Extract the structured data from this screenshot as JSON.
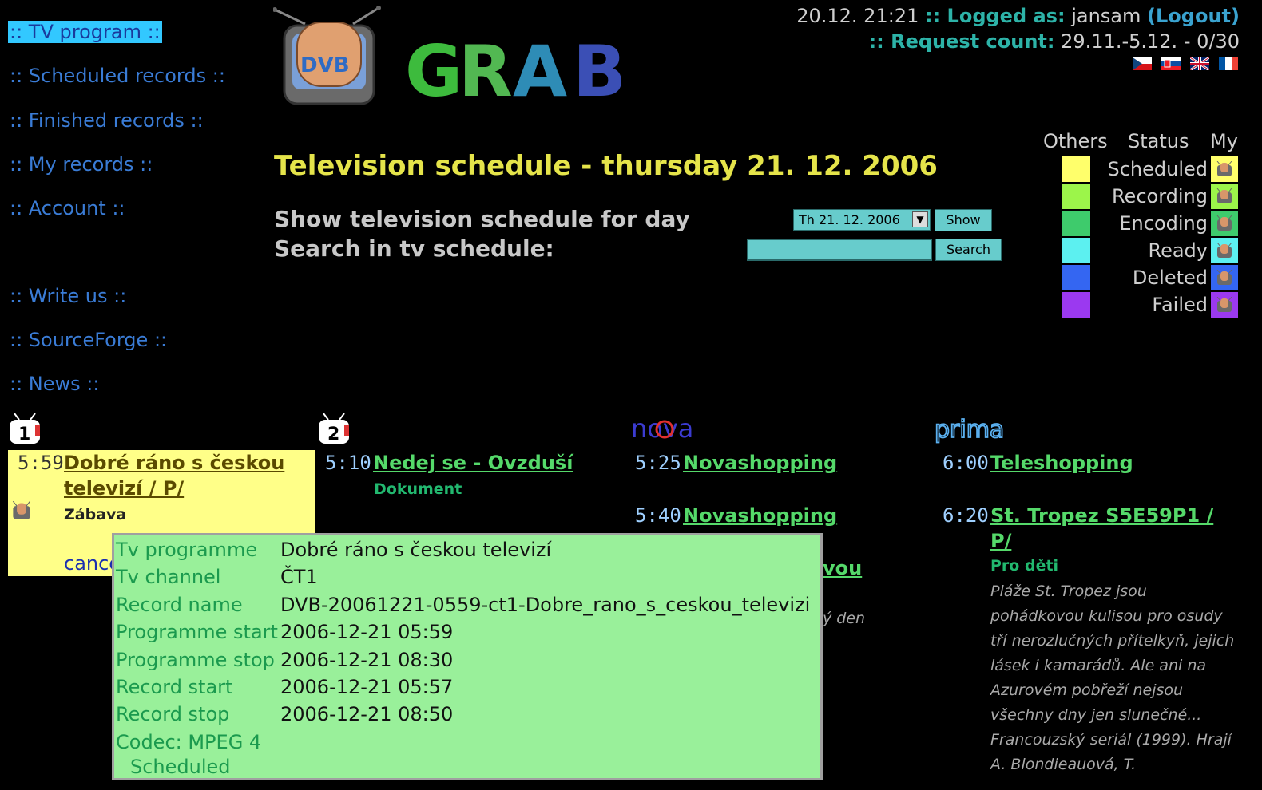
{
  "nav": {
    "items": [
      {
        "label": ":: TV program ::",
        "active": true
      },
      {
        "label": ":: Scheduled records ::"
      },
      {
        "label": ":: Finished records ::"
      },
      {
        "label": ":: My records ::"
      },
      {
        "label": ":: Account ::"
      },
      {
        "label": ":: Write us ::"
      },
      {
        "label": ":: SourceForge ::"
      },
      {
        "label": ":: News ::"
      }
    ]
  },
  "logo": {
    "badge_text": "DVB",
    "wordmark_letters": [
      "G",
      "R",
      "A",
      "B"
    ],
    "wordmark_colors": [
      "#3dbb3d",
      "#52b852",
      "#2e8cb6",
      "#3b4fb5"
    ]
  },
  "header": {
    "datetime": "20.12. 21:21",
    "logged_label": ":: Logged as:",
    "username": "jansam",
    "logout_label": "(Logout)",
    "request_label": ":: Request count:",
    "request_value": "29.11.-5.12. - 0/30",
    "flags": [
      "flag-cz-icon",
      "flag-sk-icon",
      "flag-uk-icon",
      "flag-fr-icon"
    ]
  },
  "main": {
    "title": "Television schedule - thursday 21. 12. 2006",
    "show_label": "Show television schedule for day",
    "search_label": "Search in tv schedule:",
    "day_select_value": "Th 21. 12. 2006",
    "show_button": "Show",
    "search_button": "Search",
    "search_value": ""
  },
  "legend": {
    "head_others": "Others",
    "head_status": "Status",
    "head_my": "My",
    "rows": [
      {
        "label": "Scheduled",
        "color": "#ffff6b"
      },
      {
        "label": "Recording",
        "color": "#9cf54a"
      },
      {
        "label": "Encoding",
        "color": "#3ecb6c"
      },
      {
        "label": "Ready",
        "color": "#5cf0f0"
      },
      {
        "label": "Deleted",
        "color": "#3466f2"
      },
      {
        "label": "Failed",
        "color": "#9b39f0"
      }
    ]
  },
  "channels": [
    {
      "logo": "ct1-logo",
      "logo_text": "1"
    },
    {
      "logo": "ct2-logo",
      "logo_text": "2"
    },
    {
      "logo": "nova-logo",
      "logo_text": "nova"
    },
    {
      "logo": "prima-logo",
      "logo_text": "prima"
    }
  ],
  "programmes": {
    "ct1": {
      "time": "5:59",
      "title": "Dobré ráno s českou televizí / P/",
      "genre": "Zábava",
      "cancel": "cance"
    },
    "ct2": {
      "time": "5:10",
      "title": "Nedej se - Ovzduší",
      "genre": "Dokument"
    },
    "nova": [
      {
        "time": "5:25",
        "title": "Novashopping"
      },
      {
        "time": "5:40",
        "title": "Novashopping"
      },
      {
        "title_fragment": "vou",
        "desc_fragment": "ý den"
      }
    ],
    "prima": [
      {
        "time": "6:00",
        "title": "Teleshopping"
      },
      {
        "time": "6:20",
        "title": "St. Tropez S5E59P1 / P/",
        "genre": "Pro děti",
        "desc": [
          "Pláže St. Tropez jsou",
          "pohádkovou kulisou pro osudy",
          "tří nerozlučných přítelkyň, jejich",
          "lásek i kamarádů. Ale ani na",
          "Azurovém pobřeží nejsou",
          "všechny dny jen slunečné...",
          "Francouzský seriál (1999). Hrají",
          "A. Blondieauová, T."
        ]
      }
    ]
  },
  "tooltip": {
    "rows": [
      {
        "key": "Tv programme",
        "value": "Dobré ráno s českou televizí"
      },
      {
        "key": "Tv channel",
        "value": "ČT1"
      },
      {
        "key": "Record name",
        "value": "DVB-20061221-0559-ct1-Dobre_rano_s_ceskou_televizi"
      },
      {
        "key": "Programme start",
        "value": "2006-12-21 05:59"
      },
      {
        "key": "Programme stop",
        "value": "2006-12-21 08:30"
      },
      {
        "key": "Record start",
        "value": "2006-12-21 05:57"
      },
      {
        "key": "Record stop",
        "value": "2006-12-21 08:50"
      },
      {
        "key": "Codec: MPEG 4",
        "value": ""
      }
    ],
    "status": "Scheduled"
  }
}
